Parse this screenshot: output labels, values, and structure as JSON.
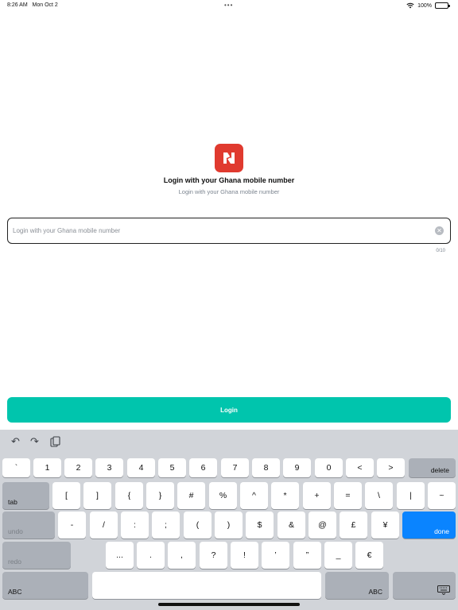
{
  "status_bar": {
    "time": "8:26 AM",
    "date": "Mon Oct 2",
    "dots": "•••",
    "battery": "100%"
  },
  "login": {
    "title": "Login with your Ghana mobile number",
    "subtitle": "Login with your Ghana mobile number",
    "input_placeholder": "Login with your Ghana mobile number",
    "input_value": "",
    "counter": "0/10",
    "button_label": "Login",
    "brand_color": "#e03a2f",
    "accent_color": "#00c5ad"
  },
  "keyboard": {
    "toolbar": {
      "undo_icon": "↶",
      "redo_icon": "↷",
      "paste_icon": "clipboard-icon"
    },
    "row1": [
      "`",
      "1",
      "2",
      "3",
      "4",
      "5",
      "6",
      "7",
      "8",
      "9",
      "0",
      "<",
      ">",
      "delete"
    ],
    "row2": [
      "tab",
      "[",
      "]",
      "{",
      "}",
      "#",
      "%",
      "^",
      "*",
      "+",
      "=",
      "\\",
      "|",
      "~"
    ],
    "row3": [
      "undo",
      "-",
      "/",
      ":",
      ";",
      "(",
      ")",
      "$",
      "&",
      "@",
      "£",
      "¥",
      "done"
    ],
    "row4": [
      "redo",
      "...",
      ".",
      ",",
      "?",
      "!",
      "’",
      "”",
      "_",
      "€"
    ],
    "row5": [
      "ABC",
      "ABC"
    ],
    "done_color": "#0a84ff"
  }
}
